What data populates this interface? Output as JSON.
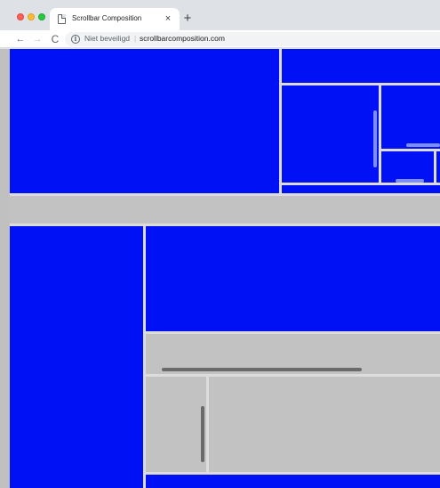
{
  "tab": {
    "title": "Scrollbar Composition",
    "close_glyph": "×",
    "new_tab_glyph": "+"
  },
  "toolbar": {
    "back_glyph": "←",
    "forward_glyph": "→",
    "reload_glyph": "C",
    "info_glyph": "i",
    "security_label": "Niet beveiligd",
    "separator": "|",
    "url": "scrollbarcomposition.com"
  },
  "icons": {
    "favicon": "page-icon",
    "info": "info-icon"
  },
  "colors": {
    "blue_panel": "#0012f5",
    "grey_panel": "#c2c2c2",
    "divider": "#dcdcdc",
    "light_thumb": "#7d8eff",
    "dark_thumb": "#6a6a6a"
  }
}
